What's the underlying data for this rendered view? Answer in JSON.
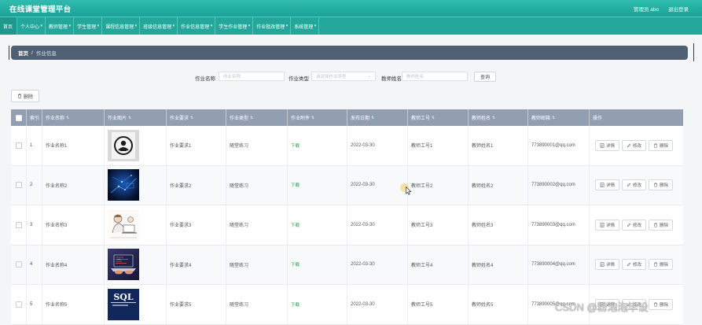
{
  "header": {
    "title": "在线课堂管理平台",
    "user": "管理员 abo",
    "logout": "退出登录"
  },
  "nav": {
    "items": [
      {
        "label": "首页",
        "dropdown": false
      },
      {
        "label": "个人中心",
        "dropdown": true
      },
      {
        "label": "教师管理",
        "dropdown": true
      },
      {
        "label": "学生管理",
        "dropdown": true
      },
      {
        "label": "课程信息管理",
        "dropdown": true
      },
      {
        "label": "班级信息管理",
        "dropdown": true
      },
      {
        "label": "作业信息管理",
        "dropdown": true
      },
      {
        "label": "学生作业管理",
        "dropdown": true
      },
      {
        "label": "作业批改管理",
        "dropdown": true
      },
      {
        "label": "系统管理",
        "dropdown": true
      }
    ]
  },
  "breadcrumb": {
    "home": "首页",
    "sep": "/",
    "current": "作业信息"
  },
  "search": {
    "name_label": "作业名称",
    "name_placeholder": "作业名称",
    "type_label": "作业类型",
    "type_placeholder": "请选择作业类型",
    "teacher_label": "教师姓名",
    "teacher_placeholder": "教师姓名",
    "button": "查询"
  },
  "toolbar": {
    "delete_label": "删除"
  },
  "table": {
    "headers": {
      "index": "索引",
      "name": "作业名称",
      "image": "作业图片",
      "requirement": "作业要求",
      "type": "作业类型",
      "attachment": "作业附件",
      "date": "发布日期",
      "teacher_id": "教师工号",
      "teacher_name": "教师姓名",
      "teacher_email": "教师邮箱",
      "actions": "操作"
    },
    "actions": {
      "detail": "详情",
      "edit": "修改",
      "delete": "删除"
    },
    "rows": [
      {
        "index": "1",
        "name": "作业名称1",
        "thumb": "circular-logo-image",
        "requirement": "作业要求1",
        "type": "随堂练习",
        "attachment": "下载",
        "date": "2022-03-30",
        "teacher_id": "教师工号1",
        "teacher_name": "教师姓名1",
        "teacher_email": "773890001@qq.com"
      },
      {
        "index": "2",
        "name": "作业名称2",
        "thumb": "blue-tech-image",
        "requirement": "作业要求2",
        "type": "随堂练习",
        "attachment": "下载",
        "date": "2022-03-30",
        "teacher_id": "教师工号2",
        "teacher_name": "教师姓名2",
        "teacher_email": "773890002@qq.com"
      },
      {
        "index": "3",
        "name": "作业名称3",
        "thumb": "sketch-illustration-image",
        "requirement": "作业要求3",
        "type": "随堂练习",
        "attachment": "下载",
        "date": "2022-03-30",
        "teacher_id": "教师工号3",
        "teacher_name": "教师姓名3",
        "teacher_email": "773890003@qq.com"
      },
      {
        "index": "4",
        "name": "作业名称4",
        "thumb": "laptop-code-image",
        "requirement": "作业要求4",
        "type": "随堂练习",
        "attachment": "下载",
        "date": "2022-03-30",
        "teacher_id": "教师工号4",
        "teacher_name": "教师姓名4",
        "teacher_email": "773890004@qq.com"
      },
      {
        "index": "5",
        "name": "作业名称5",
        "thumb": "sql-book-image",
        "thumb_text": "SQL",
        "requirement": "作业要求5",
        "type": "随堂练习",
        "attachment": "下载",
        "date": "2022-03-30",
        "teacher_id": "教师工号5",
        "teacher_name": "教师姓名5",
        "teacher_email": "773890005@qq.com"
      }
    ]
  },
  "colors": {
    "header": "#1fa99c",
    "breadcrumb": "#4f6075",
    "table_header": "#929fb1",
    "download_link": "#2c9b55"
  },
  "watermark": "CSDN @粉泡泡毕设"
}
